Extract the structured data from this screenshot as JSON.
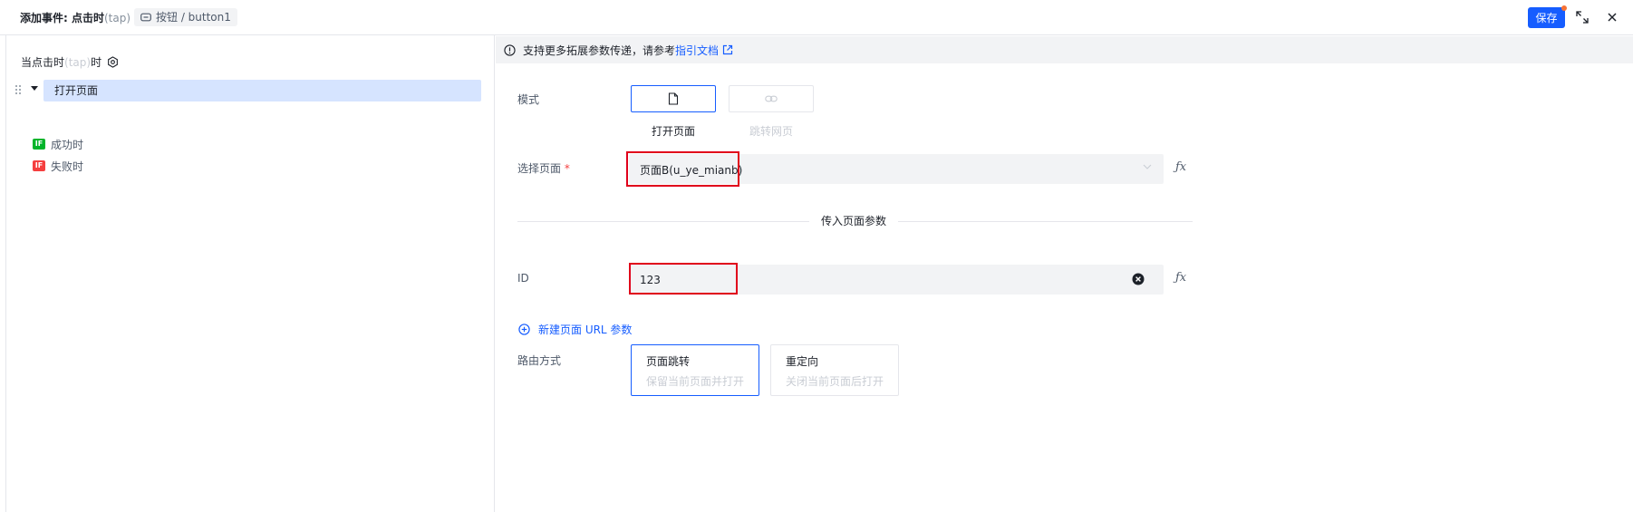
{
  "header": {
    "title": "添加事件: 点击时",
    "title_tap": "(tap)",
    "component_tag": "按钮 / button1",
    "save_label": "保存"
  },
  "left": {
    "trigger_label": "当点击时",
    "trigger_tap": "(tap)",
    "trigger_suffix": "时",
    "action_label": "打开页面",
    "branches": [
      {
        "badge": "IF",
        "label": "成功时",
        "color": "#00b42a"
      },
      {
        "badge": "IF",
        "label": "失败时",
        "color": "#f53f3f"
      }
    ]
  },
  "notice": {
    "text": "支持更多拓展参数传递，请参考",
    "link": "指引文档"
  },
  "form": {
    "mode_label": "模式",
    "modes": [
      {
        "label": "打开页面",
        "icon": "file-icon",
        "selected": true
      },
      {
        "label": "跳转网页",
        "icon": "link-icon",
        "selected": false
      }
    ],
    "page_label": "选择页面",
    "required_mark": "*",
    "page_value": "页面B(u_ye_mianb)",
    "fx_label": "ƒx",
    "params_divider": "传入页面参数",
    "id_label": "ID",
    "id_value": "123",
    "add_param_label": "新建页面 URL 参数",
    "route_label": "路由方式",
    "routes": [
      {
        "title": "页面跳转",
        "desc": "保留当前页面并打开",
        "selected": true
      },
      {
        "title": "重定向",
        "desc": "关闭当前页面后打开",
        "selected": false
      }
    ]
  },
  "colors": {
    "accent": "#165dff",
    "highlight": "#e0001b",
    "selected_row": "#d6e4ff"
  }
}
